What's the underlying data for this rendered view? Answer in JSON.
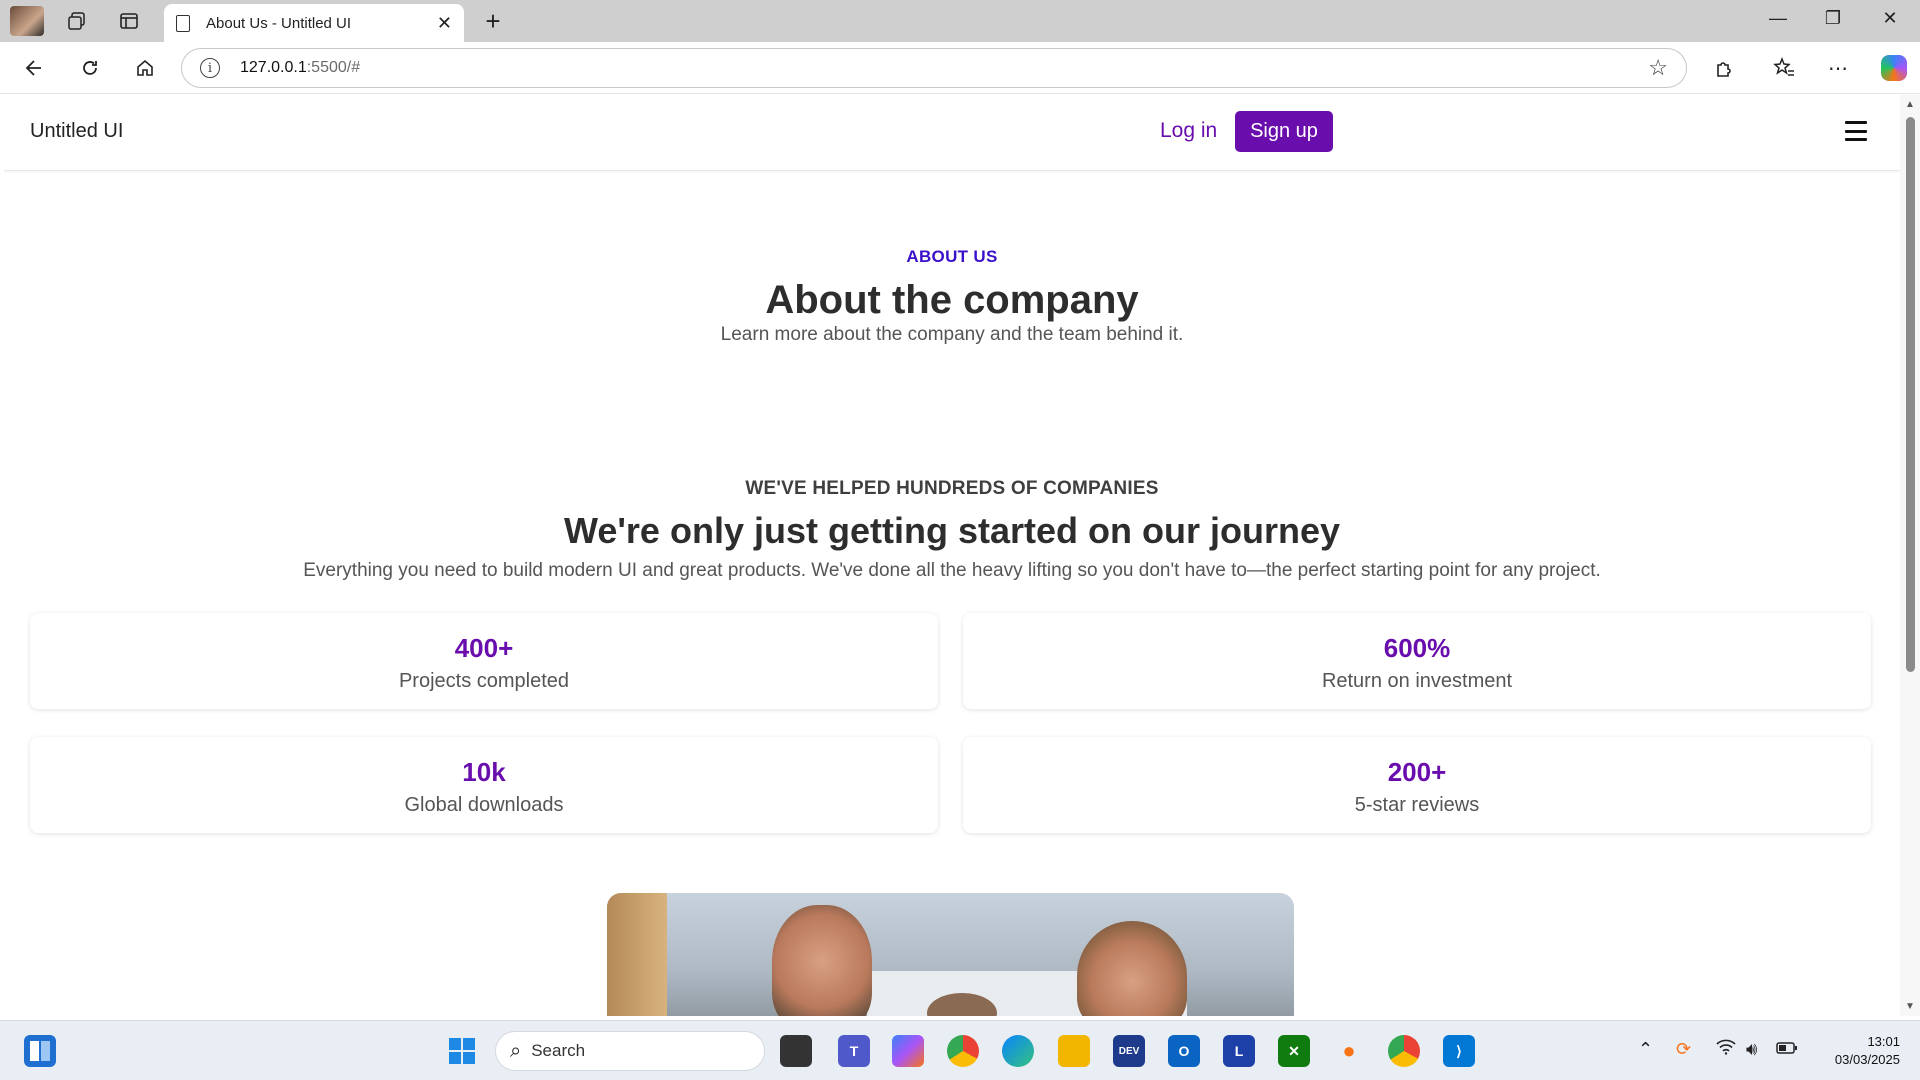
{
  "browser": {
    "tab_title": "About Us - Untitled UI",
    "url_host": "127.0.0.1",
    "url_path": ":5500/#"
  },
  "site": {
    "brand": "Untitled UI",
    "login_label": "Log in",
    "signup_label": "Sign up",
    "accent_color": "#6a0dad"
  },
  "hero": {
    "eyebrow": "ABOUT US",
    "title": "About the company",
    "subtitle": "Learn more about the company and the team behind it."
  },
  "stats_section": {
    "eyebrow": "WE'VE HELPED HUNDREDS OF COMPANIES",
    "title": "We're only just getting started on our journey",
    "subtitle": "Everything you need to build modern UI and great products. We've done all the heavy lifting so you don't have to—the perfect starting point for any project.",
    "stats": [
      {
        "value": "400+",
        "label": "Projects completed"
      },
      {
        "value": "600%",
        "label": "Return on investment"
      },
      {
        "value": "10k",
        "label": "Global downloads"
      },
      {
        "value": "200+",
        "label": "5-star reviews"
      }
    ]
  },
  "taskbar": {
    "search_label": "Search",
    "time": "13:01",
    "date": "03/03/2025"
  }
}
